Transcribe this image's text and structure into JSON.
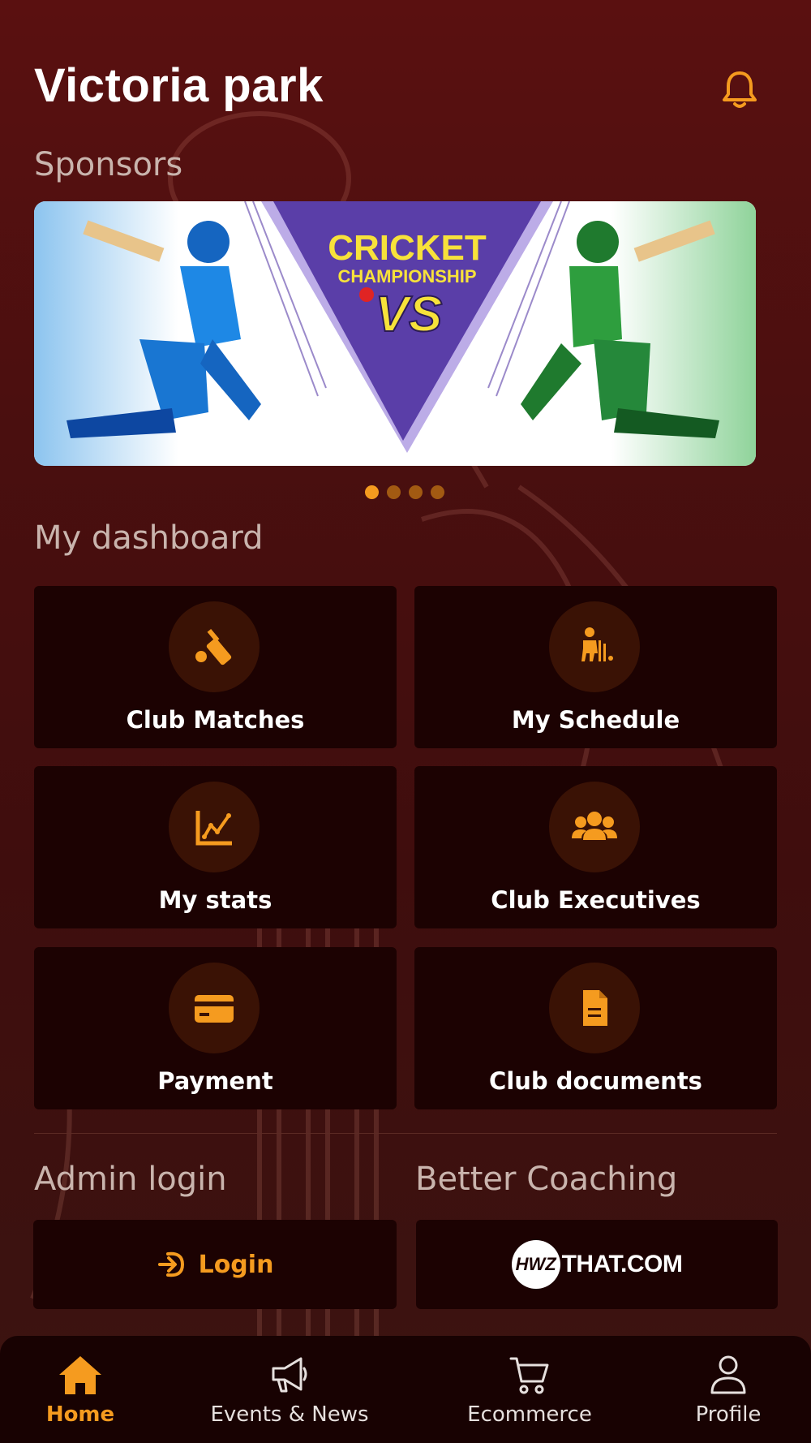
{
  "header": {
    "title": "Victoria park",
    "notifications_icon": "bell-icon"
  },
  "sponsors": {
    "label": "Sponsors",
    "banner": {
      "headline": "CRICKET",
      "subline": "CHAMPIONSHIP",
      "versus": "VS",
      "left_team_color": "#1e88e5",
      "right_team_color": "#2e9e3e",
      "center_color": "#5a3ea8"
    },
    "carousel": {
      "count": 4,
      "active_index": 0
    }
  },
  "dashboard": {
    "label": "My dashboard",
    "tiles": [
      {
        "label": "Club Matches",
        "icon": "cricket-bat-icon"
      },
      {
        "label": "My Schedule",
        "icon": "batsman-icon"
      },
      {
        "label": "My stats",
        "icon": "chart-line-icon"
      },
      {
        "label": "Club Executives",
        "icon": "users-icon"
      },
      {
        "label": "Payment",
        "icon": "credit-card-icon"
      },
      {
        "label": "Club documents",
        "icon": "document-icon"
      }
    ]
  },
  "admin": {
    "label": "Admin login",
    "button_label": "Login",
    "icon": "login-arrow-icon"
  },
  "coaching": {
    "label": "Better Coaching",
    "logo_mark": "HWZ",
    "logo_text": "THAT.COM"
  },
  "nav": {
    "items": [
      {
        "label": "Home",
        "icon": "home-icon",
        "active": true
      },
      {
        "label": "Events & News",
        "icon": "megaphone-icon",
        "active": false
      },
      {
        "label": "Ecommerce",
        "icon": "cart-icon",
        "active": false
      },
      {
        "label": "Profile",
        "icon": "user-icon",
        "active": false
      }
    ]
  },
  "colors": {
    "accent": "#f59b1f",
    "background": "#4a0f0f",
    "tile": "#1c0202"
  }
}
